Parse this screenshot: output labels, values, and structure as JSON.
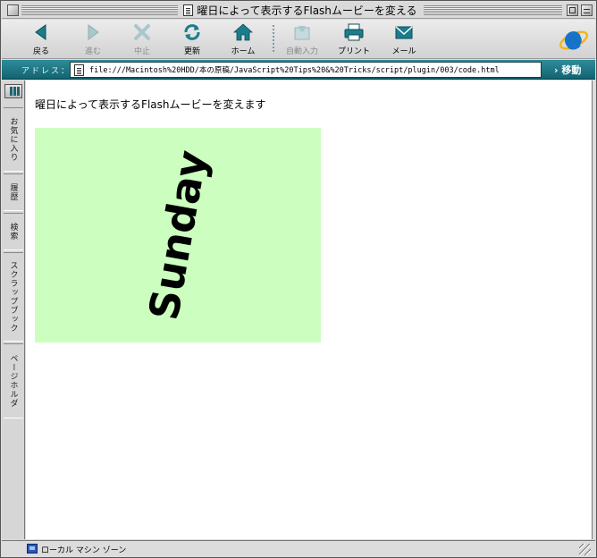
{
  "window": {
    "title": "曜日によって表示するFlashムービーを変える"
  },
  "toolbar": {
    "buttons": [
      {
        "label": "戻る",
        "icon": "back-arrow-icon",
        "enabled": true
      },
      {
        "label": "進む",
        "icon": "forward-arrow-icon",
        "enabled": false
      },
      {
        "label": "中止",
        "icon": "stop-x-icon",
        "enabled": false
      },
      {
        "label": "更新",
        "icon": "refresh-icon",
        "enabled": true
      },
      {
        "label": "ホーム",
        "icon": "home-icon",
        "enabled": true
      },
      {
        "label": "自動入力",
        "icon": "autofill-icon",
        "enabled": false
      },
      {
        "label": "プリント",
        "icon": "printer-icon",
        "enabled": true
      },
      {
        "label": "メール",
        "icon": "mail-icon",
        "enabled": true
      }
    ],
    "logo": "internet-explorer-logo"
  },
  "address": {
    "label": "アドレス：",
    "url": "file:///Macintosh%20HDD/本の原稿/JavaScript%20Tips%20&%20Tricks/script/plugin/003/code.html",
    "go_label": "› 移動"
  },
  "sidebar": {
    "tabs": [
      "お気に入り",
      "履歴",
      "検索",
      "スクラップブック",
      "ページホルダ"
    ]
  },
  "page": {
    "heading": "曜日によって表示するFlashムービーを変えます",
    "flash": {
      "text": "Sunday",
      "background": "#ccffbf"
    }
  },
  "status": {
    "zone": "ローカル マシン ゾーン"
  },
  "colors": {
    "accent": "#1d7280",
    "toolbar_icon": "#1b7d8c"
  }
}
